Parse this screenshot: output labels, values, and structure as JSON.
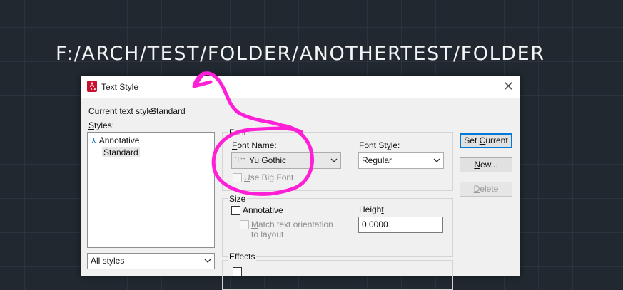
{
  "canvas": {
    "path_text": "F:/ARCH/TEST/FOLDER/ANOTHERTEST/FOLDER"
  },
  "dialog": {
    "title": "Text Style",
    "current_style_label": "Current text style:",
    "current_style_value": "Standard",
    "styles_label": "Styles:",
    "styles": [
      {
        "label": "Annotative",
        "icon": "annotative-icon"
      },
      {
        "label": "Standard",
        "selected": true
      }
    ],
    "styles_filter": "All styles",
    "font": {
      "group_label": "Font",
      "font_name_label": "Font Name:",
      "font_name_value": "Yu Gothic",
      "font_style_label": "Font Style:",
      "font_style_value": "Regular",
      "big_font_label": "Use Big Font",
      "big_font_checked": false
    },
    "size": {
      "group_label": "Size",
      "annotative_label": "Annotative",
      "annotative_checked": false,
      "match_label_1": "Match text orientation",
      "match_label_2": "to layout",
      "height_label": "Height",
      "height_value": "0.0000"
    },
    "effects": {
      "group_label": "Effects"
    },
    "buttons": {
      "set_current": "Set Current",
      "new": "New...",
      "delete": "Delete"
    }
  },
  "colors": {
    "annotation_magenta": "#ff1fd6",
    "canvas_bg": "#212830",
    "focus_blue": "#0078d7"
  }
}
